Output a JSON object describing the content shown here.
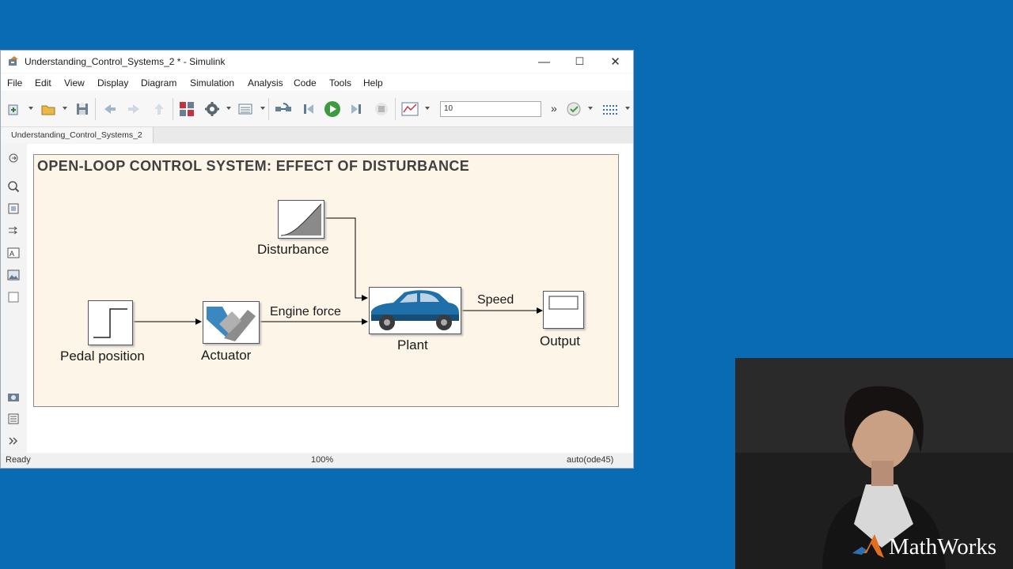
{
  "window": {
    "title": "Understanding_Control_Systems_2 * - Simulink",
    "controls": {
      "minimize": "—",
      "maximize": "☐",
      "close": "✕"
    }
  },
  "menu": [
    "File",
    "Edit",
    "View",
    "Display",
    "Diagram",
    "Simulation",
    "Analysis",
    "Code",
    "Tools",
    "Help"
  ],
  "toolbar": {
    "stop_time": "10",
    "more": "»"
  },
  "tab": {
    "label": "Understanding_Control_Systems_2"
  },
  "diagram": {
    "title": "OPEN-LOOP CONTROL SYSTEM: EFFECT OF DISTURBANCE",
    "blocks": {
      "disturbance": "Disturbance",
      "pedal": "Pedal position",
      "actuator": "Actuator",
      "plant": "Plant",
      "output": "Output"
    },
    "signals": {
      "engine_force": "Engine force",
      "speed": "Speed"
    }
  },
  "status": {
    "left": "Ready",
    "zoom": "100%",
    "solver": "auto(ode45)"
  },
  "watermark": "MathWorks",
  "colors": {
    "desktop": "#0a6bb5",
    "canvas_area": "#fdf5e8",
    "car_body": "#1f6fa8"
  }
}
